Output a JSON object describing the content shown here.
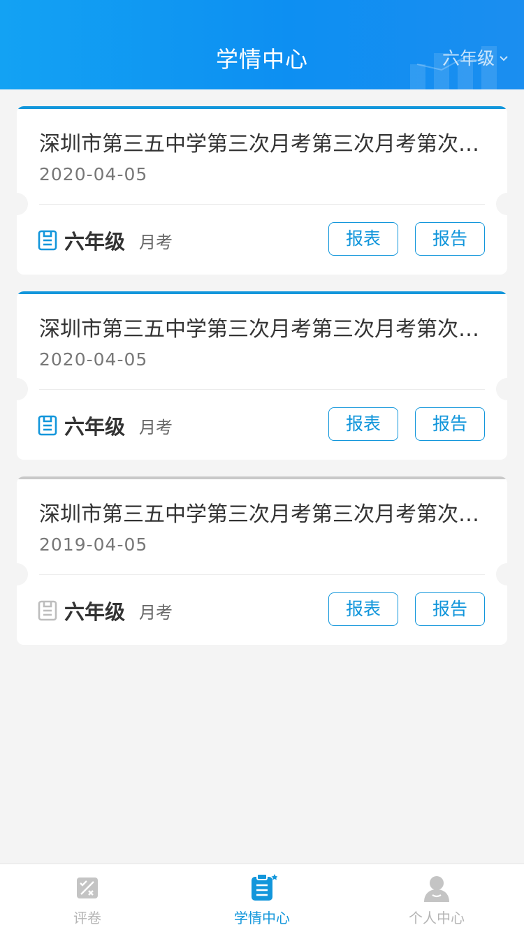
{
  "header": {
    "title": "学情中心",
    "grade_filter": "六年级"
  },
  "exams": [
    {
      "name": "深圳市第三五中学第三次月考第三次月考第次月考",
      "date": "2020-04-05",
      "grade": "六年级",
      "type": "月考",
      "report_table_label": "报表",
      "report_label": "报告",
      "accent": "#1296db",
      "icon": "clipboard-icon"
    },
    {
      "name": "深圳市第三五中学第三次月考第三次月考第次月考",
      "date": "2020-04-05",
      "grade": "六年级",
      "type": "月考",
      "report_table_label": "报表",
      "report_label": "报告",
      "accent": "#1296db",
      "icon": "clipboard-icon"
    },
    {
      "name": "深圳市第三五中学第三次月考第三次月考第次月考",
      "date": "2019-04-05",
      "grade": "六年级",
      "type": "月考",
      "report_table_label": "报表",
      "report_label": "报告",
      "accent": "#c8c8c8",
      "icon": "clipboard-icon"
    }
  ],
  "tabbar": {
    "items": [
      {
        "label": "评卷",
        "icon": "grading-icon",
        "active": false
      },
      {
        "label": "学情中心",
        "icon": "clipboard-list-icon",
        "active": true
      },
      {
        "label": "个人中心",
        "icon": "user-icon",
        "active": false
      }
    ]
  },
  "colors": {
    "primary": "#1296db",
    "header_gradient_start": "#13a2f3",
    "background": "#f4f4f4",
    "inactive": "#b5b5b5"
  }
}
